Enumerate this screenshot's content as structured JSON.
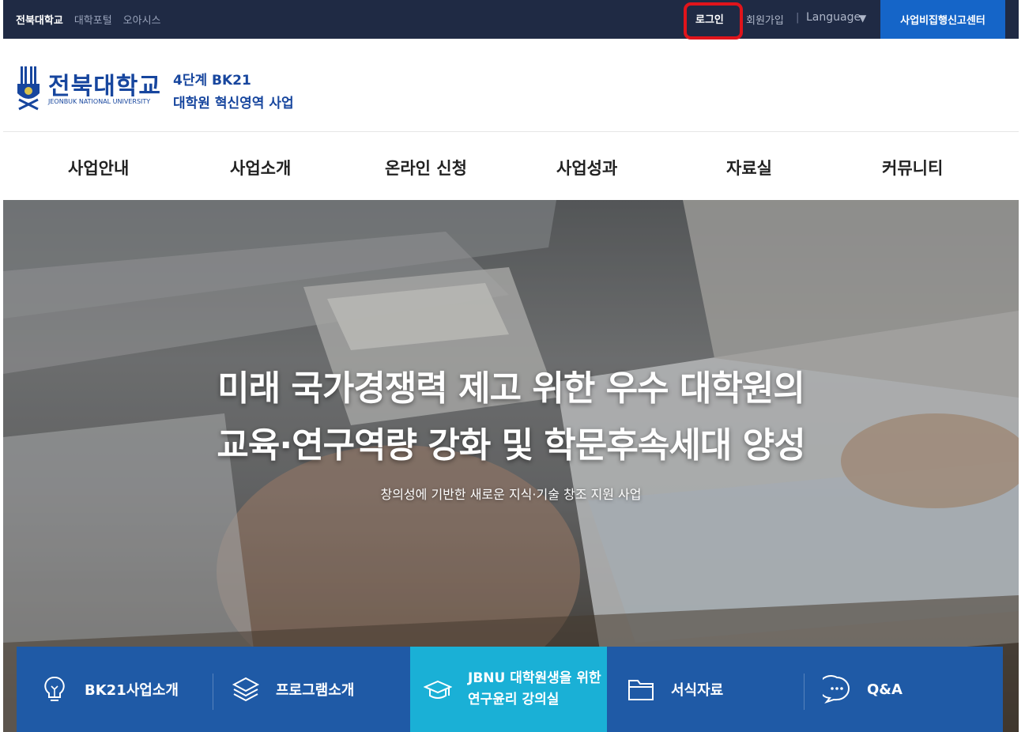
{
  "topbar": {
    "links": [
      "전북대학교",
      "대학포털",
      "오아시스"
    ],
    "login": "로그인",
    "signup": "회원가입",
    "separator": "|",
    "language": "Language",
    "language_caret": "▼",
    "report_center": "사업비집행신고센터"
  },
  "header": {
    "univ_name": "전북대학교",
    "univ_en": "JEONBUK NATIONAL UNIVERSITY",
    "bk_line1": "4단계 BK21",
    "bk_line2": "대학원 혁신영역 사업"
  },
  "nav": {
    "items": [
      "사업안내",
      "사업소개",
      "온라인 신청",
      "사업성과",
      "자료실",
      "커뮤니티"
    ]
  },
  "hero": {
    "title_line1": "미래 국가경쟁력 제고 위한 우수 대학원의",
    "title_line2": "교육·연구역량 강화 및 학문후속세대 양성",
    "subtitle": "창의성에 기반한 새로운 지식·기술 창조 지원 사업"
  },
  "quick_menu": {
    "items": [
      {
        "label": "BK21사업소개",
        "icon": "lightbulb-icon"
      },
      {
        "label": "프로그램소개",
        "icon": "layers-icon"
      },
      {
        "label_line1": "JBNU 대학원생을 위한",
        "label_line2": "연구윤리 강의실",
        "icon": "graduation-cap-icon"
      },
      {
        "label": "서식자료",
        "icon": "folder-icon"
      },
      {
        "label": "Q&A",
        "icon": "chat-bubble-icon"
      }
    ]
  },
  "colors": {
    "topbar_bg": "#1f2a44",
    "brand_blue": "#17469e",
    "report_button": "#1565c8",
    "quick_menu_bg": "#1f5aa6",
    "quick_menu_active": "#1ab0d6",
    "highlight_box": "#e0141b"
  }
}
